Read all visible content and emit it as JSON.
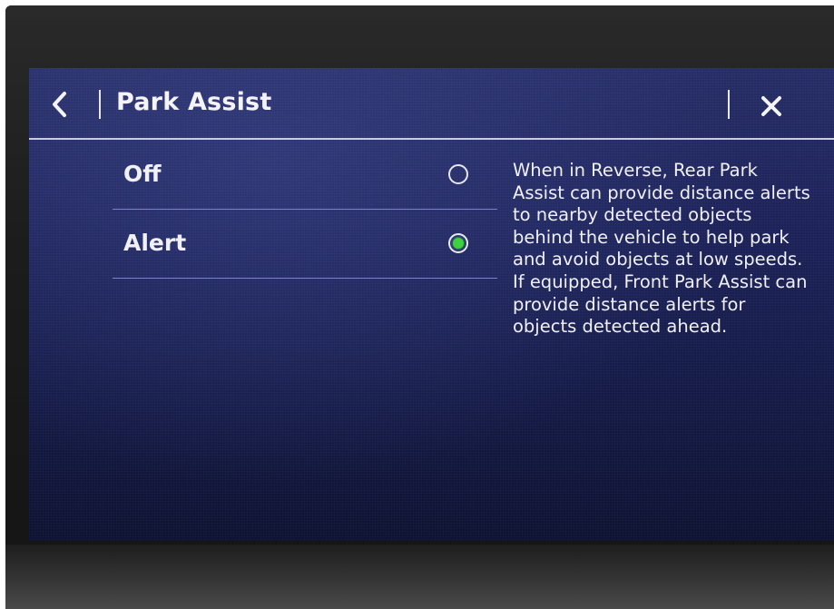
{
  "header": {
    "title": "Park Assist",
    "back_icon": "chevron-left-icon",
    "close_icon": "close-icon"
  },
  "options": [
    {
      "label": "Off",
      "selected": false
    },
    {
      "label": "Alert",
      "selected": true
    }
  ],
  "description": "When in Reverse, Rear Park Assist can provide distance alerts to nearby detected objects behind the vehicle to help park and avoid objects at low speeds. If equipped, Front Park Assist can provide distance alerts for objects detected ahead.",
  "colors": {
    "selected_radio": "#39d13c",
    "screen_background": "#1c2258",
    "divider": "#7a80c8"
  }
}
